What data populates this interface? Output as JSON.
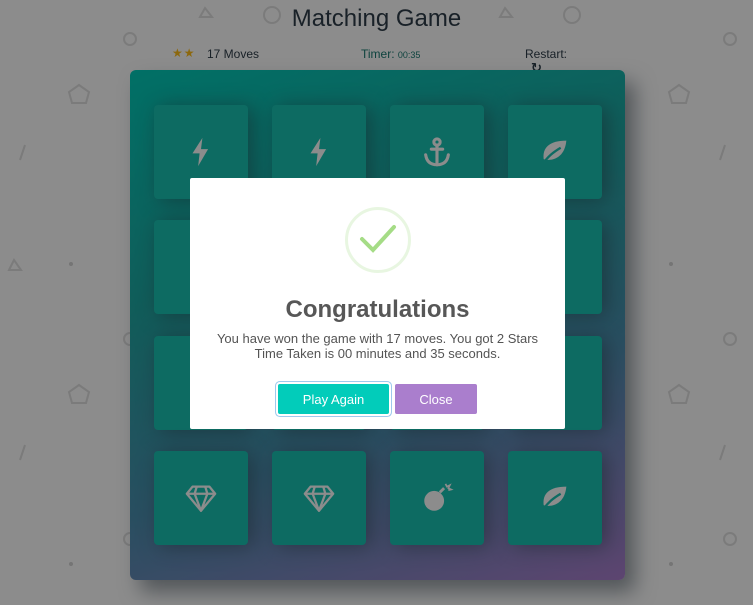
{
  "title": "Matching Game",
  "score_panel": {
    "stars": "★★",
    "star_count": 2,
    "moves_text": "17 Moves",
    "timer_label": "Timer:",
    "timer_value": "00:35",
    "restart_label": "Restart:",
    "restart_icon": "↻"
  },
  "deck": {
    "cards": [
      {
        "icon": "bolt-icon",
        "visible": true
      },
      {
        "icon": "bolt-icon",
        "visible": true
      },
      {
        "icon": "anchor-icon",
        "visible": true
      },
      {
        "icon": "leaf-icon",
        "visible": true
      },
      {
        "icon": "hidden",
        "visible": false
      },
      {
        "icon": "hidden",
        "visible": false
      },
      {
        "icon": "hidden",
        "visible": false
      },
      {
        "icon": "hidden",
        "visible": false
      },
      {
        "icon": "hidden",
        "visible": false
      },
      {
        "icon": "hidden",
        "visible": false
      },
      {
        "icon": "hidden",
        "visible": false
      },
      {
        "icon": "hidden",
        "visible": false
      },
      {
        "icon": "diamond-icon",
        "visible": true
      },
      {
        "icon": "diamond-icon",
        "visible": true
      },
      {
        "icon": "bomb-icon",
        "visible": true
      },
      {
        "icon": "leaf-icon",
        "visible": true
      }
    ]
  },
  "modal": {
    "title": "Congratulations",
    "line1": "You have won the game with 17 moves. You got 2 Stars",
    "line2": "Time Taken is 00 minutes and 35 seconds.",
    "play_again_label": "Play Again",
    "close_label": "Close"
  },
  "colors": {
    "card": "#19c3b2",
    "play_again": "#02ccba",
    "close": "#aa7ecd",
    "star": "#ffbe1a",
    "check": "#a5dc86"
  }
}
